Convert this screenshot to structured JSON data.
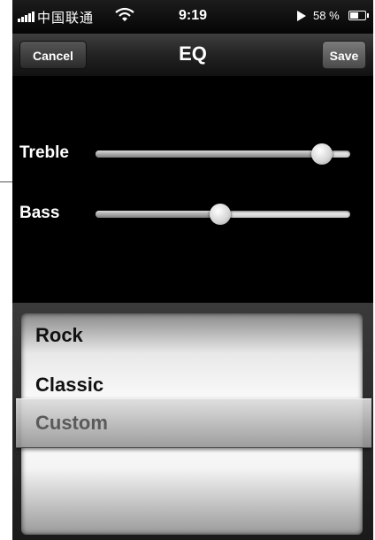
{
  "status_bar": {
    "carrier": "中国联通",
    "time": "9:19",
    "battery_percent": "58 %",
    "icons": [
      "signal-icon",
      "wifi-icon",
      "play-icon",
      "battery-icon"
    ]
  },
  "nav": {
    "title": "EQ",
    "cancel_label": "Cancel",
    "save_label": "Save"
  },
  "sliders": [
    {
      "label": "Treble",
      "value": 0.89
    },
    {
      "label": "Bass",
      "value": 0.49
    }
  ],
  "picker": {
    "items": [
      "Rock",
      "Classic"
    ],
    "selected": "Custom"
  },
  "colors": {
    "background": "#000000",
    "text": "#ffffff",
    "selected_text": "#5a5a5a"
  }
}
